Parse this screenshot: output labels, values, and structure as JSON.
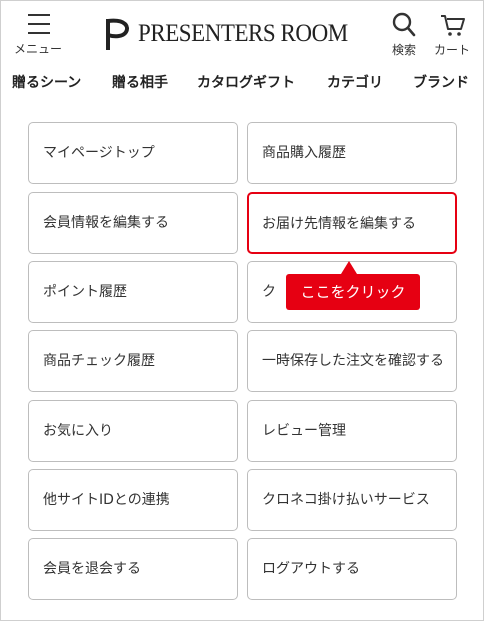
{
  "header": {
    "menu_label": "メニュー",
    "logo_text": "PRESENTERS ROOM",
    "search_label": "検索",
    "cart_label": "カート"
  },
  "nav": {
    "items": [
      "贈るシーン",
      "贈る相手",
      "カタログギフト",
      "カテゴリ",
      "ブランド"
    ]
  },
  "menu_cards": [
    "マイページトップ",
    "商品購入履歴",
    "会員情報を編集する",
    "お届け先情報を編集する",
    "ポイント履歴",
    "ク",
    "商品チェック履歴",
    "一時保存した注文を確認する",
    "お気に入り",
    "レビュー管理",
    "他サイトIDとの連携",
    "クロネコ掛け払いサービス",
    "会員を退会する",
    "ログアウトする"
  ],
  "callout": {
    "text": "ここをクリック"
  },
  "colors": {
    "highlight": "#e60012",
    "border": "#bdbdbd",
    "text": "#333333"
  }
}
